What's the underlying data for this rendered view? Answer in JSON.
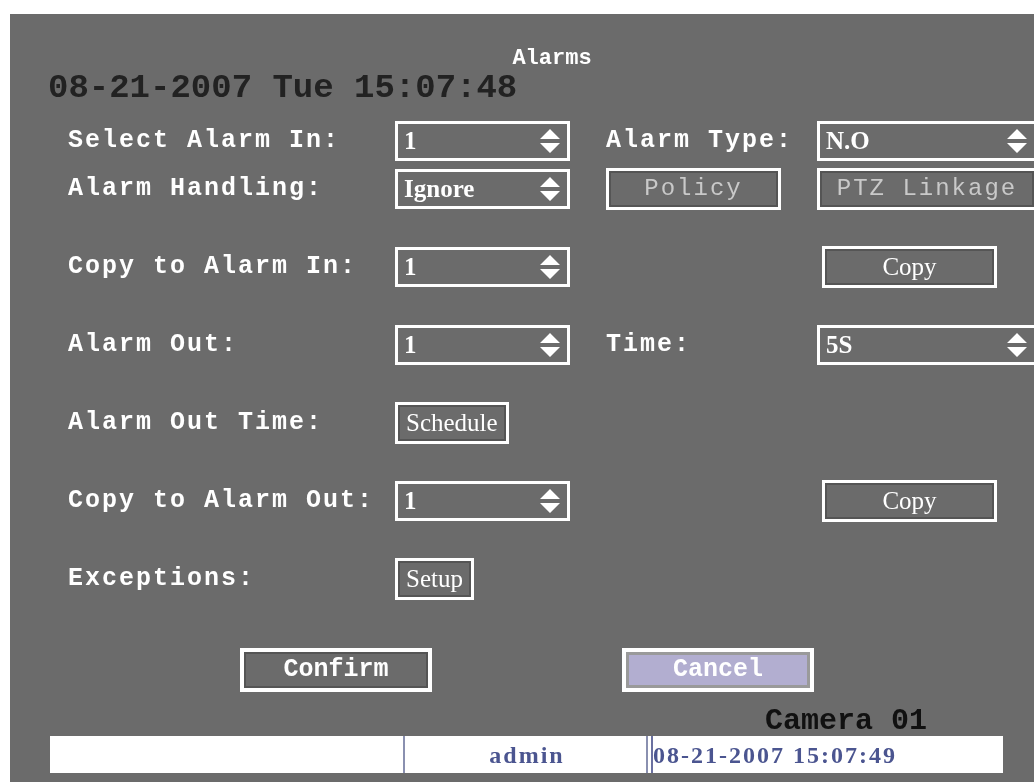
{
  "title": "Alarms",
  "osd_clock": "08-21-2007 Tue 15:07:48",
  "rows": [
    {
      "label": "Select Alarm In:",
      "field": {
        "kind": "select",
        "value": "1"
      },
      "middle": {
        "kind": "label",
        "text": "Alarm Type:"
      },
      "right": {
        "kind": "select",
        "value": "N.O"
      }
    },
    {
      "label": "Alarm Handling:",
      "field": {
        "kind": "select",
        "value": "Ignore"
      },
      "middle": {
        "kind": "button",
        "text": "Policy",
        "disabled": true
      },
      "right": {
        "kind": "button",
        "text": "PTZ Linkage",
        "disabled": true
      }
    },
    {
      "label": "Copy to Alarm In:",
      "field": {
        "kind": "select",
        "value": "1"
      },
      "right": {
        "kind": "button",
        "text": "Copy",
        "disabled": false
      }
    },
    {
      "label": "Alarm Out:",
      "field": {
        "kind": "select",
        "value": "1"
      },
      "middle": {
        "kind": "label",
        "text": "Time:"
      },
      "right": {
        "kind": "select",
        "value": "5S"
      }
    },
    {
      "label": "Alarm Out Time:",
      "field": {
        "kind": "button",
        "text": "Schedule",
        "disabled": false
      }
    },
    {
      "label": "Copy to Alarm Out:",
      "field": {
        "kind": "select",
        "value": "1"
      },
      "right": {
        "kind": "button",
        "text": "Copy",
        "disabled": false
      }
    },
    {
      "label": "Exceptions:",
      "field": {
        "kind": "button",
        "text": "Setup",
        "disabled": false
      }
    }
  ],
  "buttons": [
    {
      "text": "Confirm",
      "selected": false
    },
    {
      "text": "Cancel",
      "selected": true
    }
  ],
  "camera_label": "Camera 01",
  "status_bar": {
    "user": "admin",
    "datetime": "08-21-2007 15:07:49"
  }
}
